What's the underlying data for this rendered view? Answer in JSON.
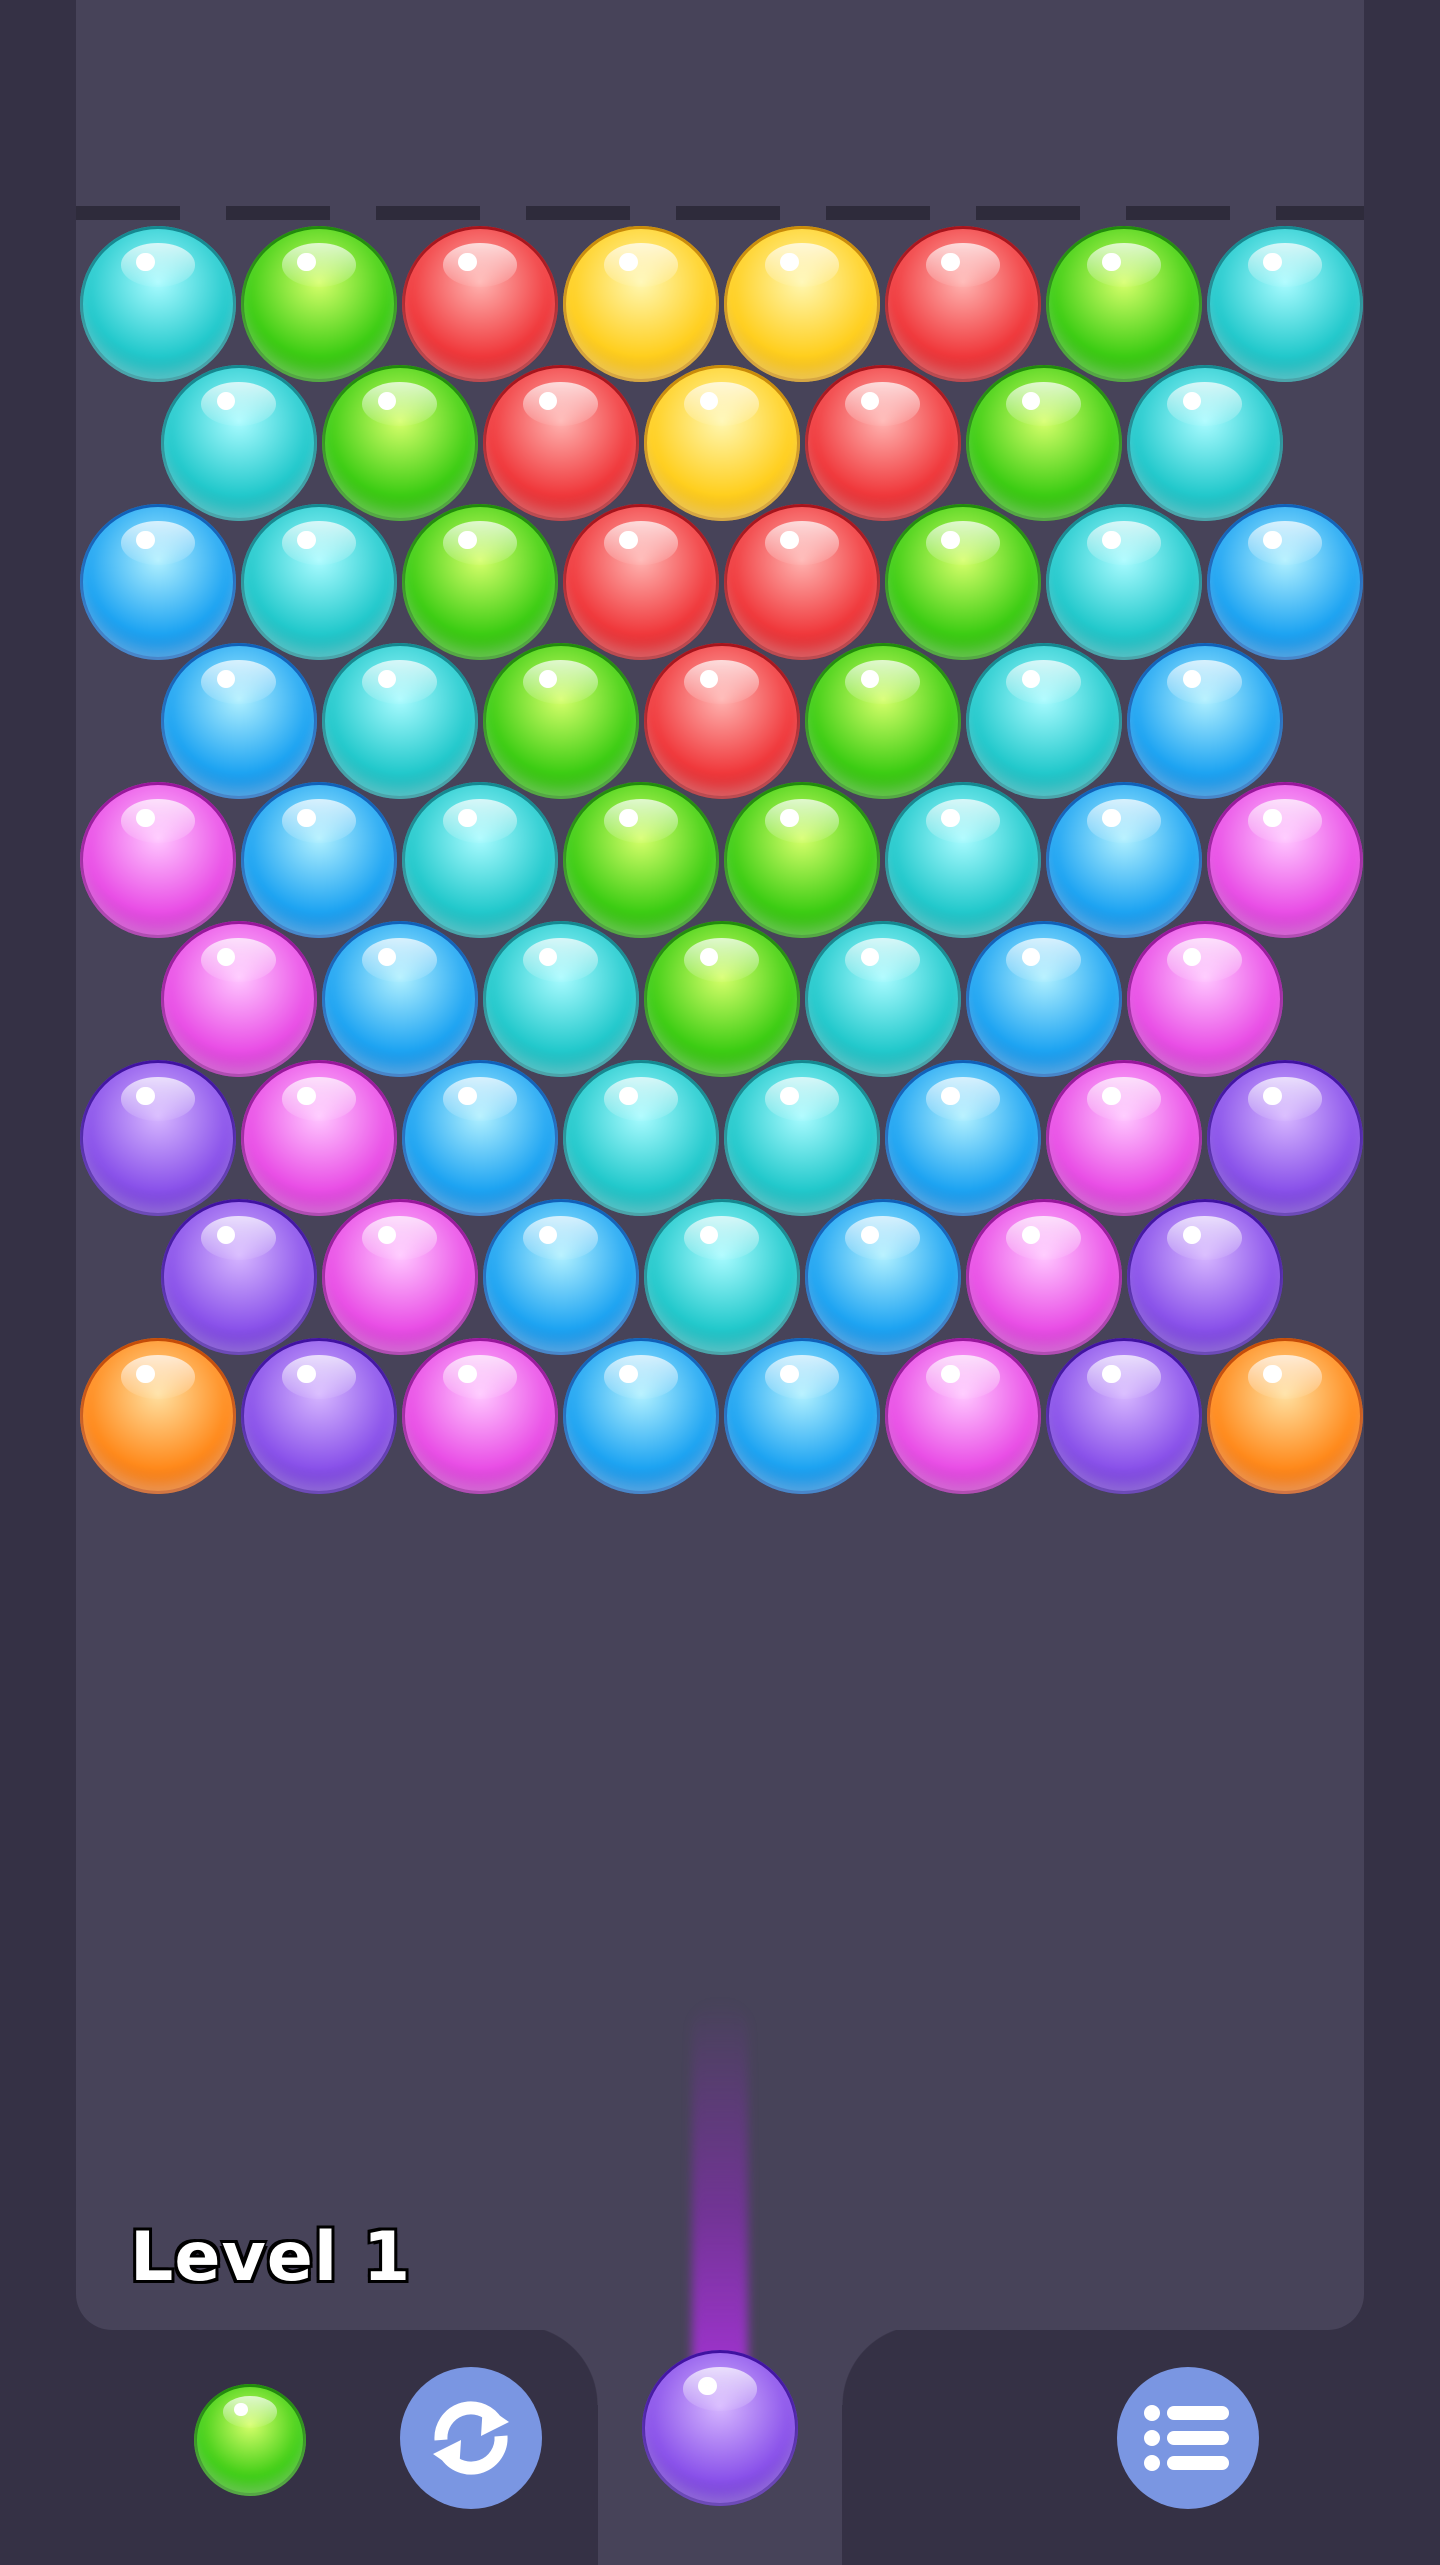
{
  "colors": {
    "background": "#353145",
    "board": "#474359",
    "button": "#7a96e2"
  },
  "palette": {
    "cyan": {
      "light": "#a8fbff",
      "mid": "#23c9cc",
      "dark": "#12878f"
    },
    "green": {
      "light": "#d6ff6a",
      "mid": "#3dcd14",
      "dark": "#1f8a0a"
    },
    "red": {
      "light": "#ffb3b0",
      "mid": "#f0393c",
      "dark": "#a5121a"
    },
    "yellow": {
      "light": "#fff7b0",
      "mid": "#ffcf1f",
      "dark": "#c98a07"
    },
    "blue": {
      "light": "#b0f0ff",
      "mid": "#1ea4f2",
      "dark": "#0e5fb8"
    },
    "pink": {
      "light": "#ffc6ff",
      "mid": "#e94fe6",
      "dark": "#97149a"
    },
    "purple": {
      "light": "#d6b6ff",
      "mid": "#8a52ea",
      "dark": "#3e10a0"
    },
    "orange": {
      "light": "#ffe0a0",
      "mid": "#ff8a1c",
      "dark": "#c44a06"
    }
  },
  "grid": [
    [
      "cyan",
      "green",
      "red",
      "yellow",
      "yellow",
      "red",
      "green",
      "cyan"
    ],
    [
      "cyan",
      "green",
      "red",
      "yellow",
      "red",
      "green",
      "cyan"
    ],
    [
      "blue",
      "cyan",
      "green",
      "red",
      "red",
      "green",
      "cyan",
      "blue"
    ],
    [
      "blue",
      "cyan",
      "green",
      "red",
      "green",
      "cyan",
      "blue"
    ],
    [
      "pink",
      "blue",
      "cyan",
      "green",
      "green",
      "cyan",
      "blue",
      "pink"
    ],
    [
      "pink",
      "blue",
      "cyan",
      "green",
      "cyan",
      "blue",
      "pink"
    ],
    [
      "purple",
      "pink",
      "blue",
      "cyan",
      "cyan",
      "blue",
      "pink",
      "purple"
    ],
    [
      "purple",
      "pink",
      "blue",
      "cyan",
      "blue",
      "pink",
      "purple"
    ],
    [
      "orange",
      "purple",
      "pink",
      "blue",
      "blue",
      "pink",
      "purple",
      "orange"
    ]
  ],
  "hud": {
    "level_label": "Level 1",
    "current_bubble": "purple",
    "next_bubble": "green",
    "swap_icon": "swap-arrows-icon",
    "menu_icon": "menu-list-icon"
  }
}
